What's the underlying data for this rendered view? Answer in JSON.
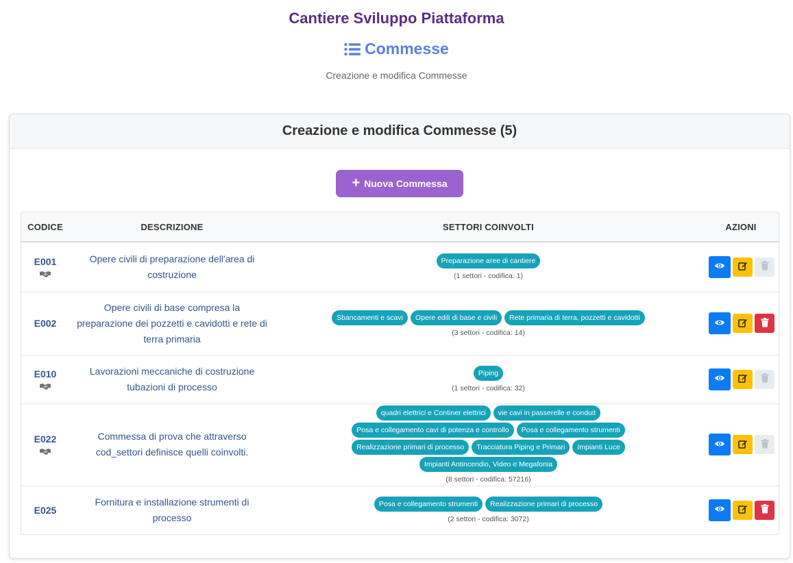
{
  "app_title": "Cantiere Sviluppo Piattaforma",
  "page": {
    "title": "Commesse",
    "subtitle": "Creazione e modifica Commesse"
  },
  "card": {
    "title": "Creazione e modifica Commesse (5)",
    "new_button_label": "Nuova Commessa"
  },
  "table": {
    "headers": {
      "code": "CODICE",
      "description": "DESCRIZIONE",
      "sectors": "SETTORI COINVOLTI",
      "actions": "AZIONI"
    },
    "rows": [
      {
        "code": "E001",
        "description": "Opere civili di preparazione dell'area di costruzione",
        "sectors": [
          "Preparazione aree di cantiere"
        ],
        "info": "(1 settori - codifica: 1)"
      },
      {
        "code": "E002",
        "description": "Opere civili di base compresa la preparazione dei pozzetti e cavidotti e rete di terra primaria",
        "sectors": [
          "Sbancamenti e scavi",
          "Opere edili di base e civili",
          "Rete primaria di terra, pozzetti e cavidotti"
        ],
        "info": "(3 settori - codifica: 14)"
      },
      {
        "code": "E010",
        "description": "Lavorazioni meccaniche di costruzione tubazioni di processo",
        "sectors": [
          "Piping"
        ],
        "info": "(1 settori - codifica: 32)"
      },
      {
        "code": "E022",
        "description": "Commessa di prova che attraverso cod_settori definisce quelli coinvolti.",
        "sectors": [
          "quadri elettrici e Continer elettrici",
          "vie cavi in passerelle e conduit",
          "Posa e collegamento cavi di potenza e controllo",
          "Posa e collegamento strumenti",
          "Realizzazione primari di processo",
          "Tracciatura Piping e Primari",
          "Impianti Luce",
          "Impianti Antincendio, Video e Megafonia"
        ],
        "info": "(8 settori - codifica: 57216)"
      },
      {
        "code": "E025",
        "description": "Fornitura e installazione strumenti di processo",
        "sectors": [
          "Posa e collegamento strumenti",
          "Realizzazione primari di processo"
        ],
        "info": "(2 settori - codifica: 3072)"
      }
    ]
  },
  "colors": {
    "accent": "#9b63cf",
    "title": "#5c2d82",
    "page_title": "#5b7fe0",
    "badge": "#17a2b8",
    "view": "#0d7bf5",
    "edit": "#ffc107",
    "delete": "#dc3545"
  },
  "icons": {
    "page": "list-icon",
    "new": "plus-icon",
    "view": "eye-icon",
    "edit": "edit-icon",
    "delete": "trash-icon",
    "handshake": "handshake-icon"
  }
}
